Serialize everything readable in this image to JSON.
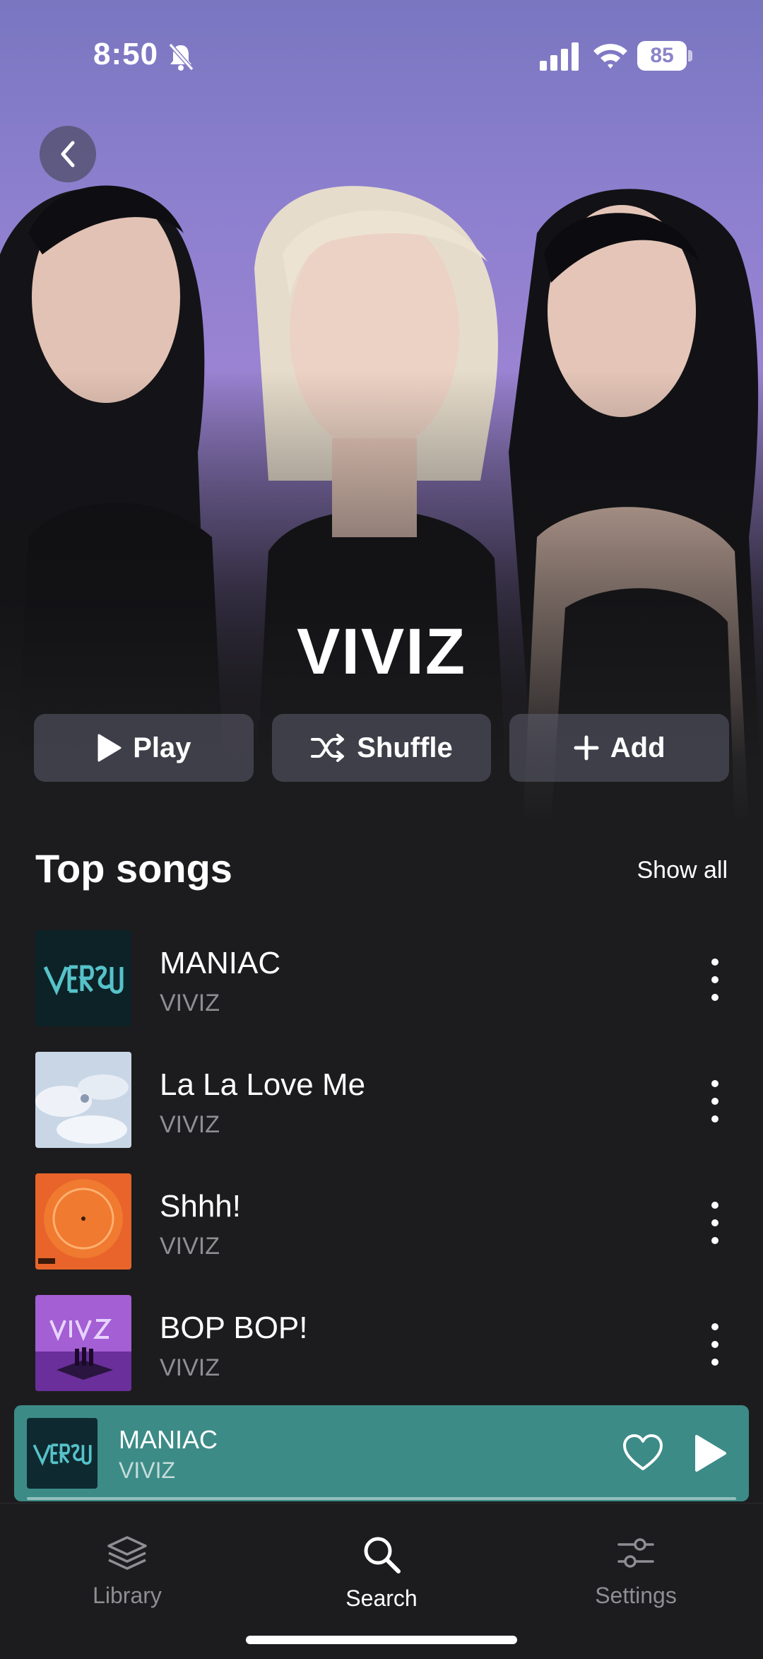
{
  "status_bar": {
    "time": "8:50",
    "battery": "85"
  },
  "artist": {
    "name": "VIVIZ"
  },
  "actions": [
    {
      "label": "Play",
      "icon": "play-icon"
    },
    {
      "label": "Shuffle",
      "icon": "shuffle-icon"
    },
    {
      "label": "Add",
      "icon": "plus-icon"
    }
  ],
  "top_songs": {
    "title": "Top songs",
    "show_all": "Show all",
    "items": [
      {
        "title": "MANIAC",
        "artist": "VIVIZ",
        "art_color": "#0e2a30"
      },
      {
        "title": "La La Love Me",
        "artist": "VIVIZ",
        "art_color": "#c9d6e6"
      },
      {
        "title": "Shhh!",
        "artist": "VIVIZ",
        "art_color": "#e8642a"
      },
      {
        "title": "BOP BOP!",
        "artist": "VIVIZ",
        "art_color": "#a45fd4"
      }
    ]
  },
  "now_playing": {
    "title": "MANIAC",
    "artist": "VIVIZ"
  },
  "tabs": [
    {
      "label": "Library",
      "icon": "library-icon",
      "active": false
    },
    {
      "label": "Search",
      "icon": "search-icon",
      "active": true
    },
    {
      "label": "Settings",
      "icon": "settings-icon",
      "active": false
    }
  ],
  "colors": {
    "background": "#1c1c1e",
    "mini_player": "#3c8b87",
    "secondary_text": "#8e8e93"
  }
}
